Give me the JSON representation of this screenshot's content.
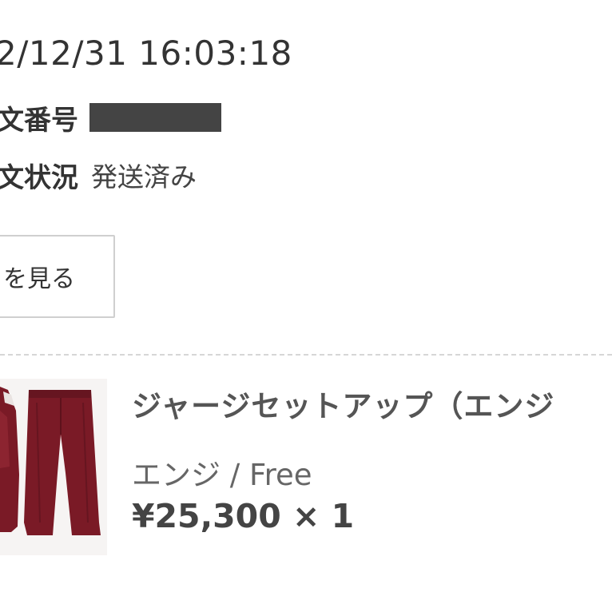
{
  "order": {
    "date": "2/12/31 16:03:18",
    "number_label": "文番号",
    "status_label": "文状況",
    "status_value": "発送済み"
  },
  "detail_button": {
    "label": "を見る"
  },
  "product": {
    "title": "ジャージセットアップ（エンジ",
    "variant": "エンジ / Free",
    "price": "¥25,300 × 1",
    "color": "#7a1a26"
  }
}
